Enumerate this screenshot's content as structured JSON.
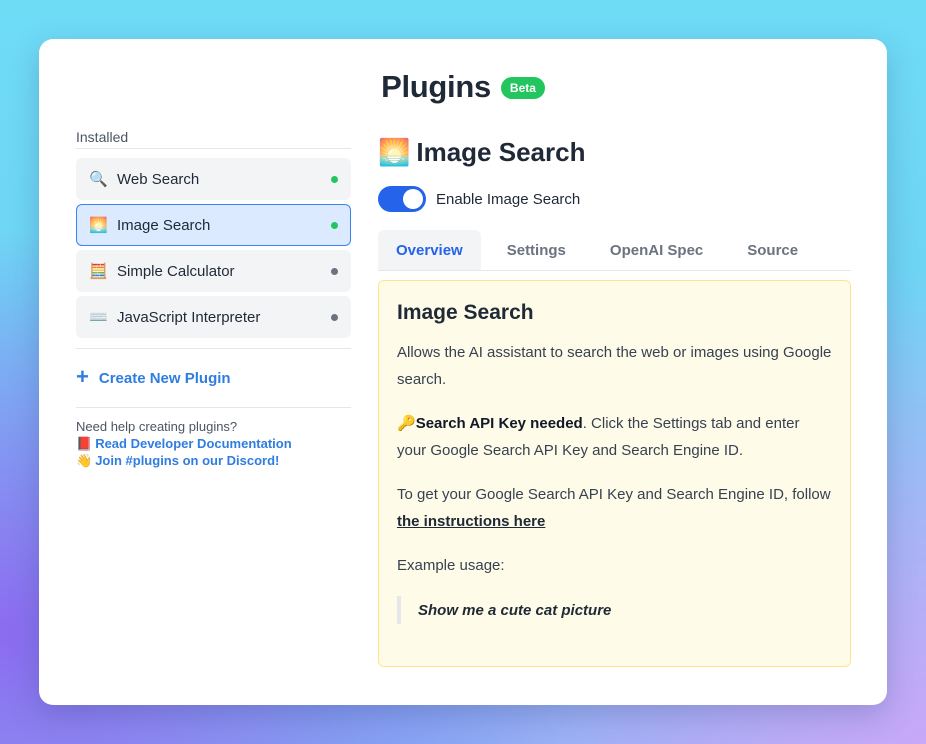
{
  "header": {
    "title": "Plugins",
    "badge": "Beta"
  },
  "sidebar": {
    "section_label": "Installed",
    "items": [
      {
        "icon": "🔍",
        "icon_name": "magnifier-icon",
        "label": "Web Search",
        "enabled": true
      },
      {
        "icon": "🌅",
        "icon_name": "sunrise-image-icon",
        "label": "Image Search",
        "enabled": true,
        "selected": true
      },
      {
        "icon": "🧮",
        "icon_name": "abacus-icon",
        "label": "Simple Calculator",
        "enabled": false
      },
      {
        "icon": "⌨️",
        "icon_name": "keyboard-icon",
        "label": "JavaScript Interpreter",
        "enabled": false
      }
    ],
    "create_label": "Create New Plugin",
    "help": {
      "question": "Need help creating plugins?",
      "docs_icon": "📕",
      "docs_link": "Read Developer Documentation",
      "discord_icon": "👋",
      "discord_link": "Join #plugins on our Discord!"
    }
  },
  "main": {
    "icon": "🌅",
    "title": "Image Search",
    "toggle_label": "Enable Image Search",
    "toggle_on": true,
    "tabs": [
      {
        "label": "Overview",
        "active": true
      },
      {
        "label": "Settings"
      },
      {
        "label": "OpenAI Spec"
      },
      {
        "label": "Source"
      }
    ],
    "overview": {
      "heading": "Image Search",
      "description": "Allows the AI assistant to search the web or images using Google search.",
      "key_icon": "🔑",
      "key_bold": "Search API Key needed",
      "key_text": ". Click the Settings tab and enter your Google Search API Key and Search Engine ID.",
      "instructions_prefix": "To get your Google Search API Key and Search Engine ID, follow ",
      "instructions_link": "the instructions here",
      "example_label": "Example usage:",
      "example_quote": "Show me a cute cat picture"
    }
  },
  "colors": {
    "accent": "#2563eb",
    "link": "#2f7de1",
    "enabled_dot": "#22c55e",
    "disabled_dot": "#6b7280",
    "panel_bg": "#fefce8",
    "beta_badge": "#22c55e"
  }
}
